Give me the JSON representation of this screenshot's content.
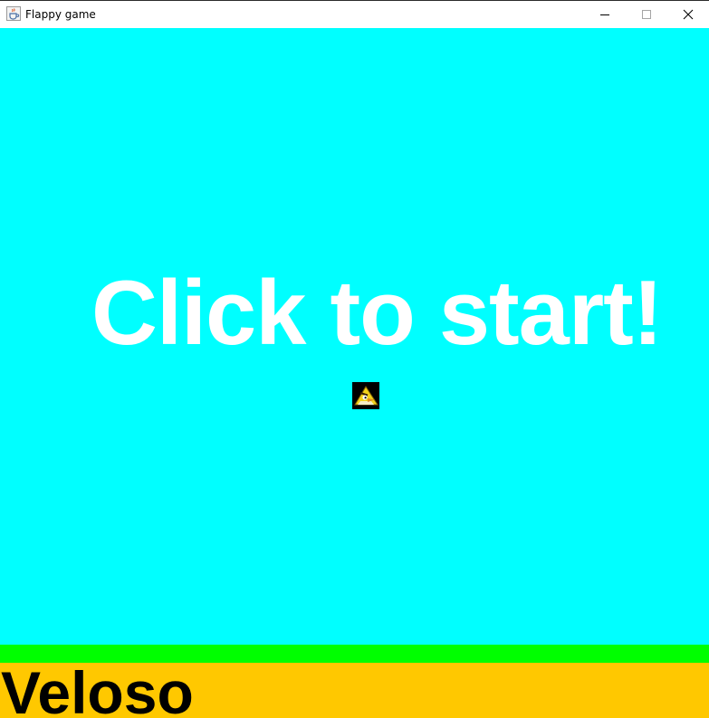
{
  "window": {
    "title": "Flappy game",
    "app_icon": "java-cup-icon",
    "controls": {
      "minimize_icon": "minimize-icon",
      "maximize_icon": "maximize-icon",
      "close_icon": "close-icon"
    }
  },
  "game": {
    "start_message": "Click to start!",
    "ground_label": "Veloso",
    "bird_icon": "angry-bird-icon",
    "colors": {
      "sky": "#00ffff",
      "grass": "#00ff00",
      "ground": "#ffc800",
      "message": "#ffffff",
      "ground_text": "#000000"
    }
  }
}
